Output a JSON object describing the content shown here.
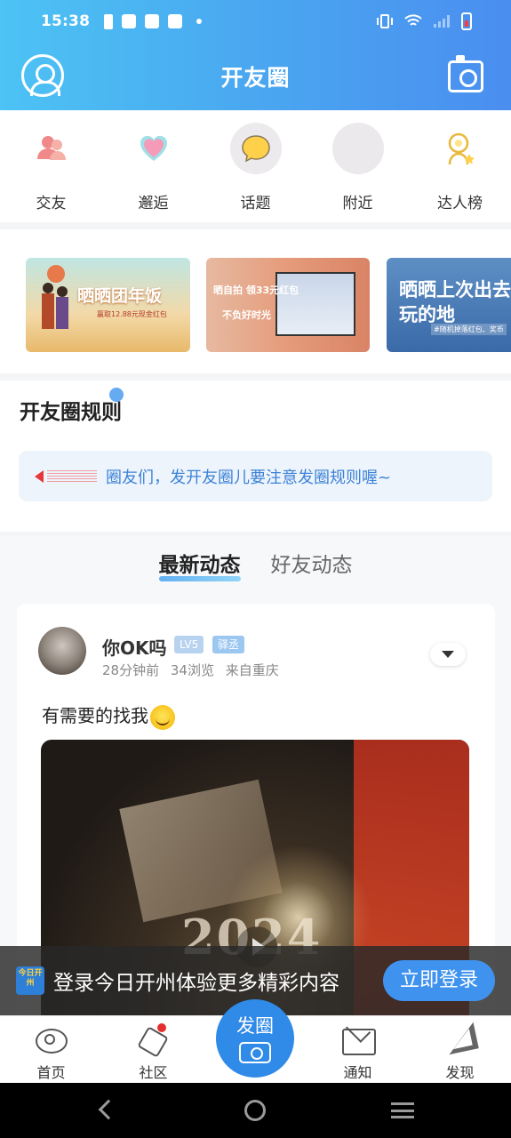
{
  "status_bar": {
    "time": "15:38"
  },
  "header": {
    "title": "开友圈"
  },
  "shortcuts": [
    {
      "label": "交友",
      "icon": "friends-icon"
    },
    {
      "label": "邂逅",
      "icon": "heart-icon"
    },
    {
      "label": "话题",
      "icon": "topic-bubble-icon"
    },
    {
      "label": "附近",
      "icon": "nearby-icon"
    },
    {
      "label": "达人榜",
      "icon": "ranking-badge-icon"
    }
  ],
  "banners": [
    {
      "title": "晒晒团年饭",
      "subtitle": "赢取12.88元现金红包"
    },
    {
      "title": "晒自拍 领33元红包",
      "subtitle": "不负好时光"
    },
    {
      "title": "晒晒上次出去玩的地",
      "subtitle": "#随机掉落红包、奖币"
    }
  ],
  "rules": {
    "title": "开友圈规则",
    "notice": "圈友们，发开友圈儿要注意发圈规则喔~"
  },
  "feed_tabs": [
    {
      "label": "最新动态",
      "active": true
    },
    {
      "label": "好友动态",
      "active": false
    }
  ],
  "post": {
    "username": "你OK吗",
    "level": "LV5",
    "badge": "驿丞",
    "time": "28分钟前",
    "views": "34浏览",
    "location": "来自重庆",
    "text": "有需要的找我",
    "image_caption": "2024"
  },
  "login_bar": {
    "logo_text": "今日开州",
    "text": "登录今日开州体验更多精彩内容",
    "button": "立即登录"
  },
  "tabbar": {
    "items": [
      {
        "label": "首页",
        "icon": "eye-icon"
      },
      {
        "label": "社区",
        "icon": "hexagon-icon"
      },
      {
        "label": "通知",
        "icon": "mail-icon"
      },
      {
        "label": "发现",
        "icon": "paper-plane-icon"
      }
    ],
    "fab_label": "发圈"
  },
  "colors": {
    "header_gradient_start": "#4cc3f4",
    "header_gradient_end": "#4a8ef0",
    "accent": "#2f8ae8",
    "notice_text": "#3c82d8"
  }
}
